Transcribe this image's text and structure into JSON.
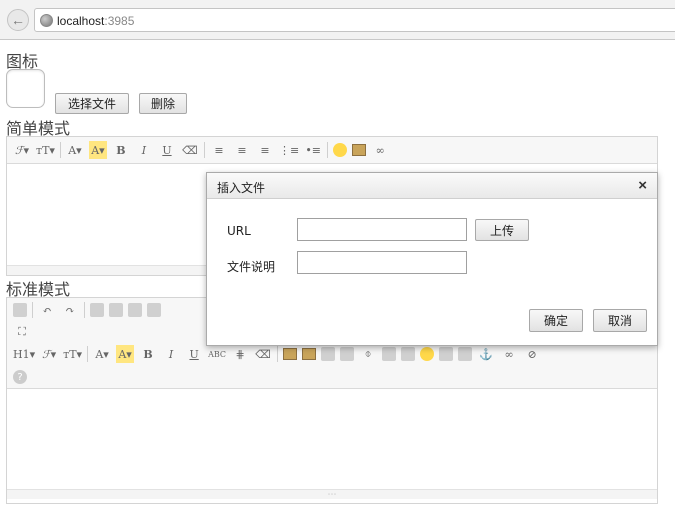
{
  "browser": {
    "host": "localhost",
    "port": ":3985"
  },
  "page": {
    "icon_label": "图标",
    "choose_file": "选择文件",
    "delete": "删除",
    "simple_mode": "简单模式",
    "standard_mode": "标准模式"
  },
  "simple_toolbar": {
    "font_family": "ℱ▾",
    "font_size": "ᴛT▾",
    "font_color": "A▾",
    "bg_color": "A▾",
    "bold": "B",
    "italic": "I",
    "underline": "U",
    "eraser": "⌫",
    "align_left": "≡",
    "align_center": "≡",
    "align_right": "≡",
    "ordered_list": "⋮≡",
    "unordered_list": "•≡",
    "link": "∞"
  },
  "standard_toolbar": {
    "row1": [
      "📋",
      "↶",
      "↷",
      "🔍",
      "🖨",
      "☰",
      "C#",
      "🔗"
    ],
    "row2": [
      "⛶"
    ],
    "row3": {
      "heading": "H1▾",
      "font_family": "ℱ▾",
      "font_size": "ᴛT▾",
      "font_color": "A▾",
      "bg_color": "A▾",
      "bold": "B",
      "italic": "I",
      "underline": "U",
      "strike": "ABC",
      "table_grid": "⋕",
      "eraser": "⌫",
      "attachment": "⌽",
      "anchor": "⚓",
      "link": "∞",
      "unlink": "⊘"
    },
    "row4_help": "?"
  },
  "dialog": {
    "title": "插入文件",
    "close": "×",
    "url_label": "URL",
    "url_value": "",
    "upload": "上传",
    "desc_label": "文件说明",
    "desc_value": "",
    "ok": "确定",
    "cancel": "取消"
  },
  "resize_handle": "⋯"
}
